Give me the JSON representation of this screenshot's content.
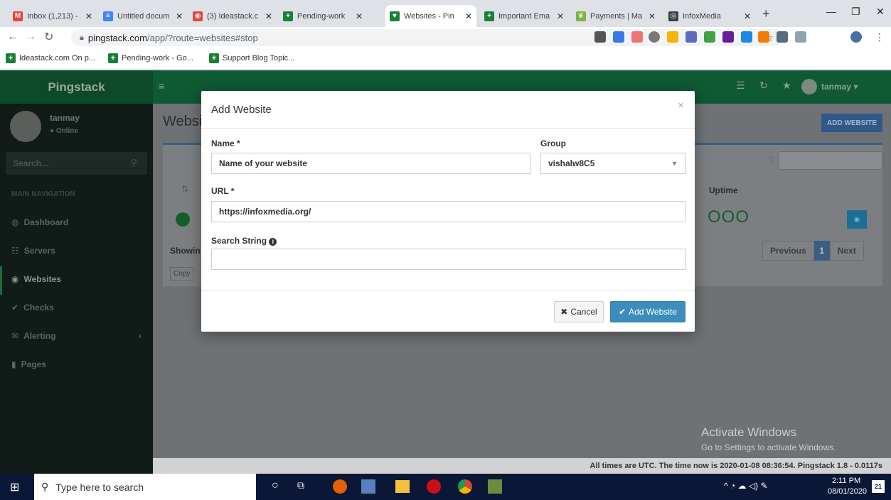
{
  "browser": {
    "tabs": [
      {
        "title": "Inbox (1,213) -",
        "color": "#ea4335",
        "glyph": "M"
      },
      {
        "title": "Untitled docum",
        "color": "#4285f4",
        "glyph": "≡"
      },
      {
        "title": "(3) Ideastack.c",
        "color": "#e2453c",
        "glyph": "◉"
      },
      {
        "title": "Pending-work",
        "color": "#188038",
        "glyph": "+"
      },
      {
        "title": "Websites - Pin",
        "color": "#188038",
        "glyph": "♥"
      },
      {
        "title": "Important Ema",
        "color": "#188038",
        "glyph": "+"
      },
      {
        "title": "Payments | Ma",
        "color": "#7cb342",
        "glyph": "❦"
      },
      {
        "title": "InfoxMedia",
        "color": "#3c4043",
        "glyph": "◎"
      }
    ],
    "new_tab": "+",
    "url_host": "pingstack.com",
    "url_path": "/app/?route=websites#stop",
    "bookmarks": [
      "Ideastack.com On p...",
      "Pending-work - Go...",
      "Support Blog Topic..."
    ]
  },
  "app": {
    "brand": "Pingstack",
    "user": {
      "name": "tanmay",
      "status": "Online"
    },
    "topnav_user": "tanmay",
    "search_placeholder": "Search...",
    "nav_header": "MAIN NAVIGATION",
    "nav": [
      "Dashboard",
      "Servers",
      "Websites",
      "Checks",
      "Alerting",
      "Pages"
    ],
    "page_title": "Websi",
    "add_website_button": "ADD WEBSITE",
    "col_uptime": "Uptime",
    "uptime_value": "OOO",
    "showing": "Showin",
    "copy": "Copy",
    "pagination": {
      "prev": "Previous",
      "page": "1",
      "next": "Next"
    }
  },
  "modal": {
    "title": "Add Website",
    "close": "×",
    "name_label": "Name *",
    "name_value": "Name of your website",
    "group_label": "Group",
    "group_value": "vishalw8C5",
    "url_label": "URL *",
    "url_value": "https://infoxmedia.org/",
    "search_label": "Search String",
    "search_value": "",
    "cancel": "Cancel",
    "submit": "Add Website"
  },
  "watermark": {
    "line1": "Activate Windows",
    "line2": "Go to Settings to activate Windows."
  },
  "footer": "All times are UTC. The time now is 2020-01-08 08:36:54. Pingstack 1.8 - 0.0117s",
  "taskbar": {
    "search": "Type here to search",
    "time": "2:11 PM",
    "date": "08/01/2020",
    "notif": "21"
  }
}
